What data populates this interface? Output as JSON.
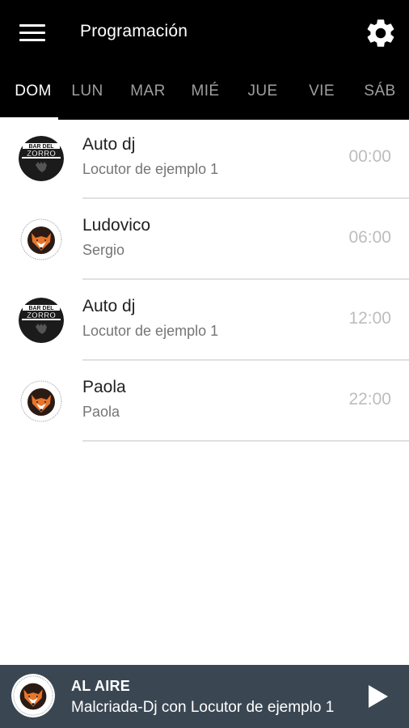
{
  "header": {
    "title": "Programación",
    "menu_icon": "hamburger-menu-icon",
    "settings_icon": "gear-icon"
  },
  "tabs": [
    {
      "label": "DOM",
      "active": true
    },
    {
      "label": "LUN",
      "active": false
    },
    {
      "label": "MAR",
      "active": false
    },
    {
      "label": "MIÉ",
      "active": false
    },
    {
      "label": "JUE",
      "active": false
    },
    {
      "label": "VIE",
      "active": false
    },
    {
      "label": "SÁB",
      "active": false
    }
  ],
  "schedule": [
    {
      "title": "Auto dj",
      "host": "Locutor de ejemplo 1",
      "time": "00:00",
      "logo": "bar-del-zorro-logo",
      "logo_text": [
        "BAR DEL",
        "ZORRO"
      ]
    },
    {
      "title": "Ludovico",
      "host": "Sergio",
      "time": "06:00",
      "logo": "fox-logo"
    },
    {
      "title": "Auto dj",
      "host": "Locutor de ejemplo 1",
      "time": "12:00",
      "logo": "bar-del-zorro-logo",
      "logo_text": [
        "BAR DEL",
        "ZORRO"
      ]
    },
    {
      "title": "Paola",
      "host": "Paola",
      "time": "22:00",
      "logo": "fox-logo"
    }
  ],
  "player": {
    "label": "AL AIRE",
    "track": "Malcriada-Dj con Locutor de ejemplo 1",
    "play_icon": "play-icon"
  },
  "colors": {
    "appbar": "#000000",
    "player": "#3a4753",
    "fox_orange": "#e8752a"
  }
}
